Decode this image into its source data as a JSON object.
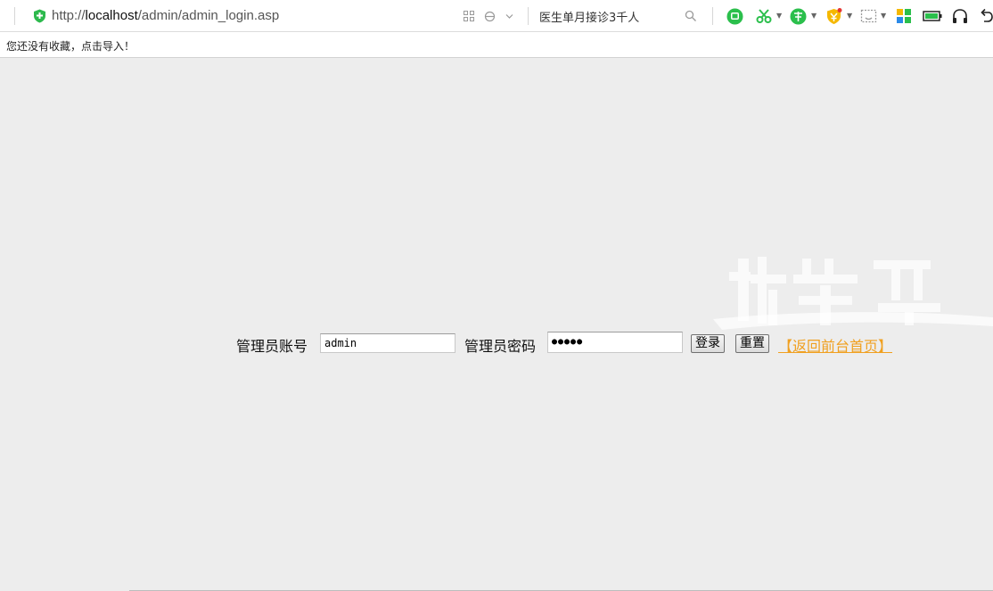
{
  "browser": {
    "url_scheme": "http://",
    "url_host": "localhost",
    "url_path": "/admin/admin_login.asp",
    "search_text": "医生单月接诊3千人",
    "bookmark_hint": "您还没有收藏，点击导入！",
    "colors": {
      "shield": "#2db94d",
      "ext_green": "#2bbf4c",
      "ext_yellow": "#f5b800"
    }
  },
  "login": {
    "account_label": "管理员账号",
    "account_value": "admin",
    "password_label": "管理员密码",
    "password_value": "●●●●●",
    "login_button": "登录",
    "reset_button": "重置",
    "home_link": "【返回前台首页】",
    "link_color": "#f0a020"
  }
}
